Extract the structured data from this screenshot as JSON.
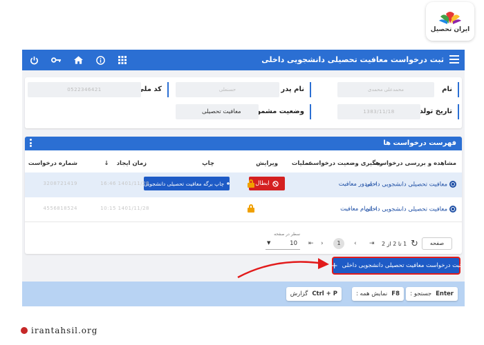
{
  "logo": {
    "text": "ایران تحصیل"
  },
  "topbar": {
    "title": "ثبت درخواست معافیت تحصیلی دانشجویی داخلی",
    "icons": [
      "power-icon",
      "key-icon",
      "home-icon",
      "info-icon",
      "grid-icon"
    ]
  },
  "form": {
    "name_label": "نام",
    "name_value": "محمدعلی محمدی",
    "father_label": "نام پدر",
    "father_value": "حسنعلی",
    "national_code_label": "کد ملی",
    "national_code_value": "0522346421",
    "birth_label": "تاریخ تولد",
    "birth_value": "1383/11/18",
    "status_label": "وضعیت مشمول",
    "status_value": "معافیت تحصیلی"
  },
  "list": {
    "title": "فهرست درخواست ها",
    "columns": {
      "view": "مشاهده و بررسی درخواست",
      "track": "رهگیری وضعیت درخواست",
      "ops": "عملیات",
      "edit": "ویرایش",
      "print": "چاپ",
      "created": "زمان ایجاد",
      "number": "شماره درخواست"
    },
    "rows": [
      {
        "view": "معافیت تحصیلی دانشجویی داخلی",
        "track": "صدور معافیت",
        "cancel": "ابطال",
        "print": "چاپ برگه معافیت تحصیلی دانشجویی",
        "created": "1401/11/28 16:46",
        "number": "3208721419"
      },
      {
        "view": "معافیت تحصیلی دانشجویی داخلی",
        "track": "اتمام معافیت",
        "created": "1401/11/28 10:15",
        "number": "4556818524"
      }
    ]
  },
  "pager": {
    "label": "صفحه",
    "count": "1 تا 2 از 2",
    "current": "1",
    "size_caption": "سطر در صفحه",
    "size_value": "10"
  },
  "new_request": "ثبت درخواست معافیت تحصیلی دانشجویی داخلی",
  "footer": {
    "search_key": "Enter",
    "search_label": "جستجو :",
    "show_all_key": "F8",
    "show_all_label": "نمایش همه :",
    "report_key": "Ctrl + P",
    "report_label": "گزارش"
  },
  "site": "irantahsil.org",
  "colors": {
    "primary": "#2b6fd3",
    "danger": "#d42020",
    "lock": "#f0a000",
    "footer": "#b8d3f3"
  }
}
